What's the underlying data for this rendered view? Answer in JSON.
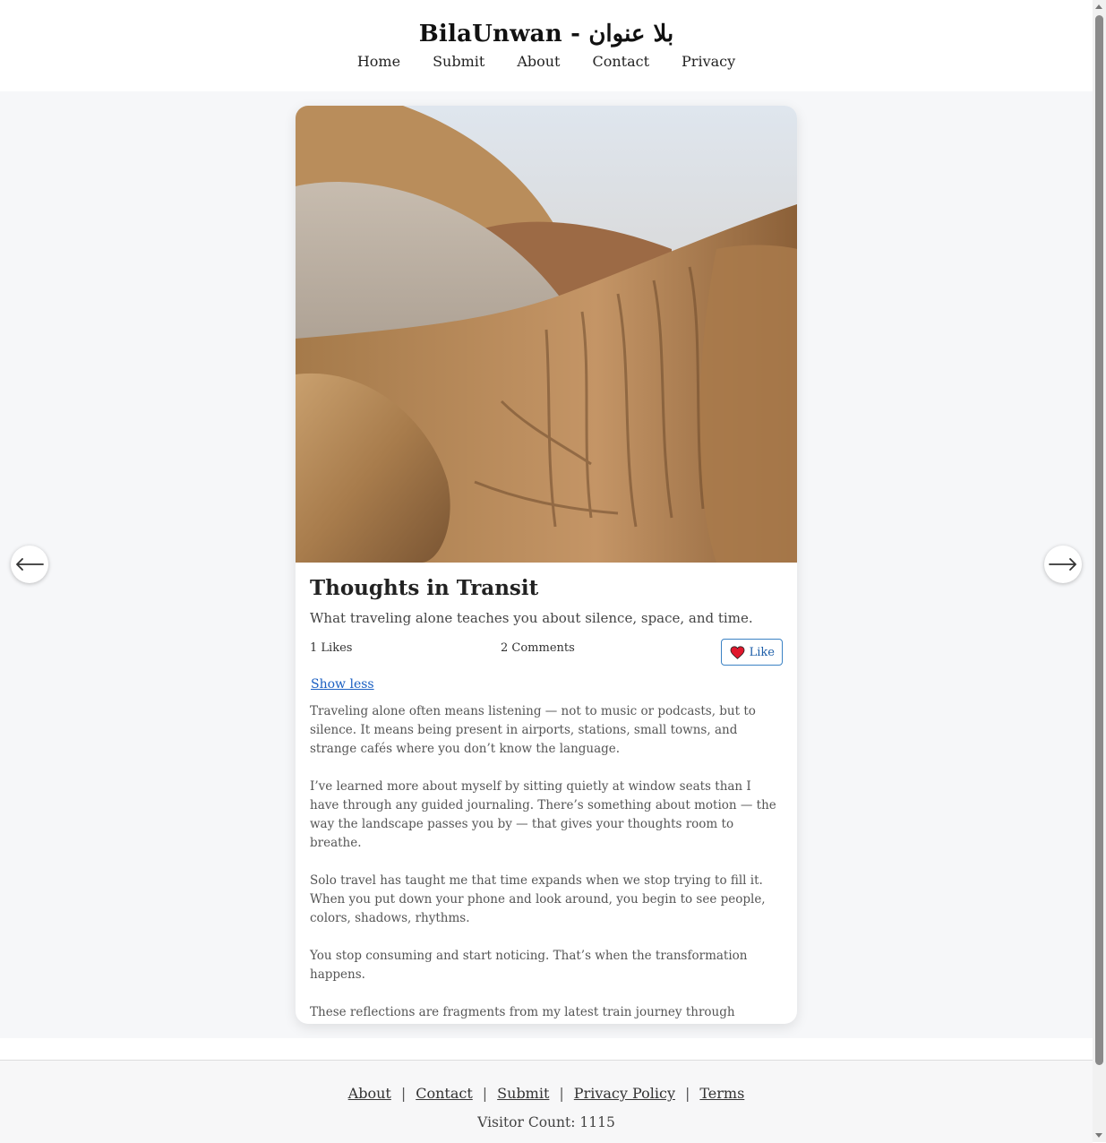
{
  "header": {
    "site_title": "BilaUnwan - بلا عنوان",
    "nav": [
      "Home",
      "Submit",
      "About",
      "Contact",
      "Privacy"
    ]
  },
  "post": {
    "image_alt": "walrus",
    "title": "Thoughts in Transit",
    "subtitle": "What traveling alone teaches you about silence, space, and time.",
    "likes": "1 Likes",
    "comments": "2 Comments",
    "like_label": "Like",
    "toggle_label": "Show less",
    "paragraphs": [
      "Traveling alone often means listening — not to music or podcasts, but to silence. It means being present in airports, stations, small towns, and strange cafés where you don’t know the language.",
      "I’ve learned more about myself by sitting quietly at window seats than I have through any guided journaling. There’s something about motion — the way the landscape passes you by — that gives your thoughts room to breathe.",
      "Solo travel has taught me that time expands when we stop trying to fill it. When you put down your phone and look around, you begin to see people, colors, shadows, rhythms.",
      "You stop consuming and start noticing. That’s when the transformation happens.",
      "These reflections are fragments from my latest train journey through eastern Europe. I took no photos. Just notes. And here they are."
    ]
  },
  "navigation": {
    "prev_icon": "arrow-left-icon",
    "next_icon": "arrow-right-icon"
  },
  "footer": {
    "links": [
      "About",
      "Contact",
      "Submit",
      "Privacy Policy",
      "Terms"
    ],
    "separator": "|",
    "visitor_count": "Visitor Count: 1115"
  },
  "colors": {
    "accent": "#1a5fc2",
    "heart": "#e0182d",
    "background": "#f6f7f9"
  }
}
